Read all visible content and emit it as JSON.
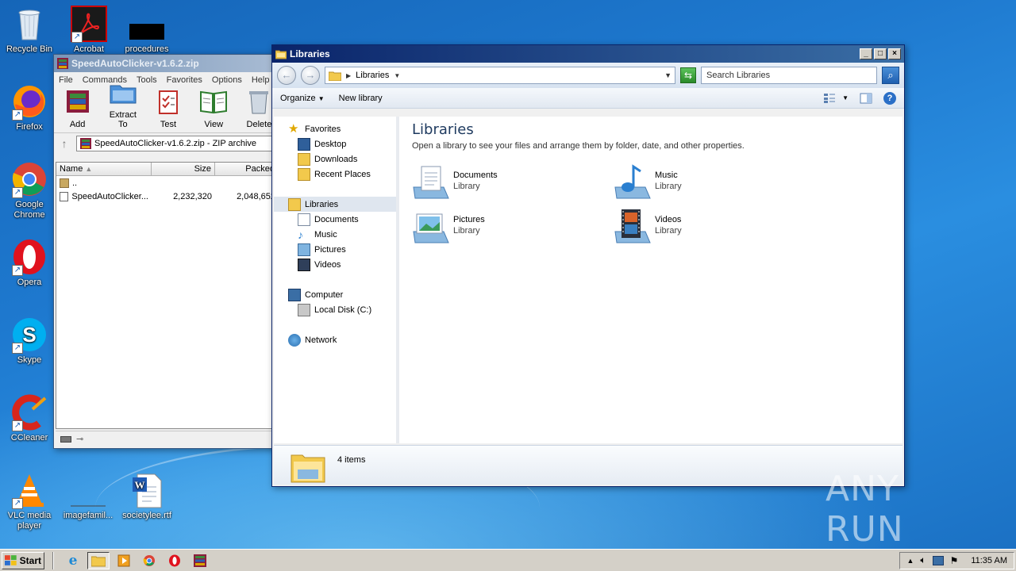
{
  "desktop": {
    "icons": [
      {
        "label": "Recycle Bin",
        "icon": "recycle-bin-icon"
      },
      {
        "label": "Acrobat",
        "icon": "acrobat-icon"
      },
      {
        "label": "procedures",
        "icon": "file-icon"
      },
      {
        "label": "Firefox",
        "icon": "firefox-icon"
      },
      {
        "label": "Google Chrome",
        "icon": "chrome-icon"
      },
      {
        "label": "Opera",
        "icon": "opera-icon"
      },
      {
        "label": "Skype",
        "icon": "skype-icon"
      },
      {
        "label": "CCleaner",
        "icon": "ccleaner-icon"
      },
      {
        "label": "VLC media player",
        "icon": "vlc-icon"
      },
      {
        "label": "imagefamil...",
        "icon": "image-file-icon"
      },
      {
        "label": "societylee.rtf",
        "icon": "word-document-icon"
      }
    ],
    "watermark": "ANY RUN"
  },
  "winrar": {
    "title": "SpeedAutoClicker-v1.6.2.zip",
    "menu": [
      "File",
      "Commands",
      "Tools",
      "Favorites",
      "Options",
      "Help"
    ],
    "toolbar": [
      {
        "label": "Add",
        "icon": "add-archive-icon"
      },
      {
        "label": "Extract To",
        "icon": "extract-folder-icon"
      },
      {
        "label": "Test",
        "icon": "test-clipboard-icon"
      },
      {
        "label": "View",
        "icon": "view-book-icon"
      },
      {
        "label": "Delete",
        "icon": "trash-icon"
      }
    ],
    "path": "SpeedAutoClicker-v1.6.2.zip - ZIP archive",
    "columns": [
      "Name",
      "Size",
      "Packed"
    ],
    "rows": [
      {
        "name": "..",
        "size": "",
        "packed": ""
      },
      {
        "name": "SpeedAutoClicker...",
        "size": "2,232,320",
        "packed": "2,048,652"
      }
    ]
  },
  "explorer": {
    "title": "Libraries",
    "breadcrumb": "Libraries",
    "search_placeholder": "Search Libraries",
    "commands": {
      "organize": "Organize",
      "new_library": "New library"
    },
    "nav": {
      "favorites": "Favorites",
      "favorites_items": [
        "Desktop",
        "Downloads",
        "Recent Places"
      ],
      "libraries": "Libraries",
      "libraries_items": [
        "Documents",
        "Music",
        "Pictures",
        "Videos"
      ],
      "computer": "Computer",
      "computer_items": [
        "Local Disk (C:)"
      ],
      "network": "Network"
    },
    "heading": "Libraries",
    "description": "Open a library to see your files and arrange them by folder, date, and other properties.",
    "libraries": [
      {
        "name": "Documents",
        "type": "Library",
        "icon": "documents-library-icon"
      },
      {
        "name": "Music",
        "type": "Library",
        "icon": "music-library-icon"
      },
      {
        "name": "Pictures",
        "type": "Library",
        "icon": "pictures-library-icon"
      },
      {
        "name": "Videos",
        "type": "Library",
        "icon": "videos-library-icon"
      }
    ],
    "status": "4 items"
  },
  "taskbar": {
    "start_label": "Start",
    "clock": "11:35 AM"
  },
  "colors": {
    "titlebar_active": "#0a246a",
    "desktop_bg": "#1e79cf"
  }
}
